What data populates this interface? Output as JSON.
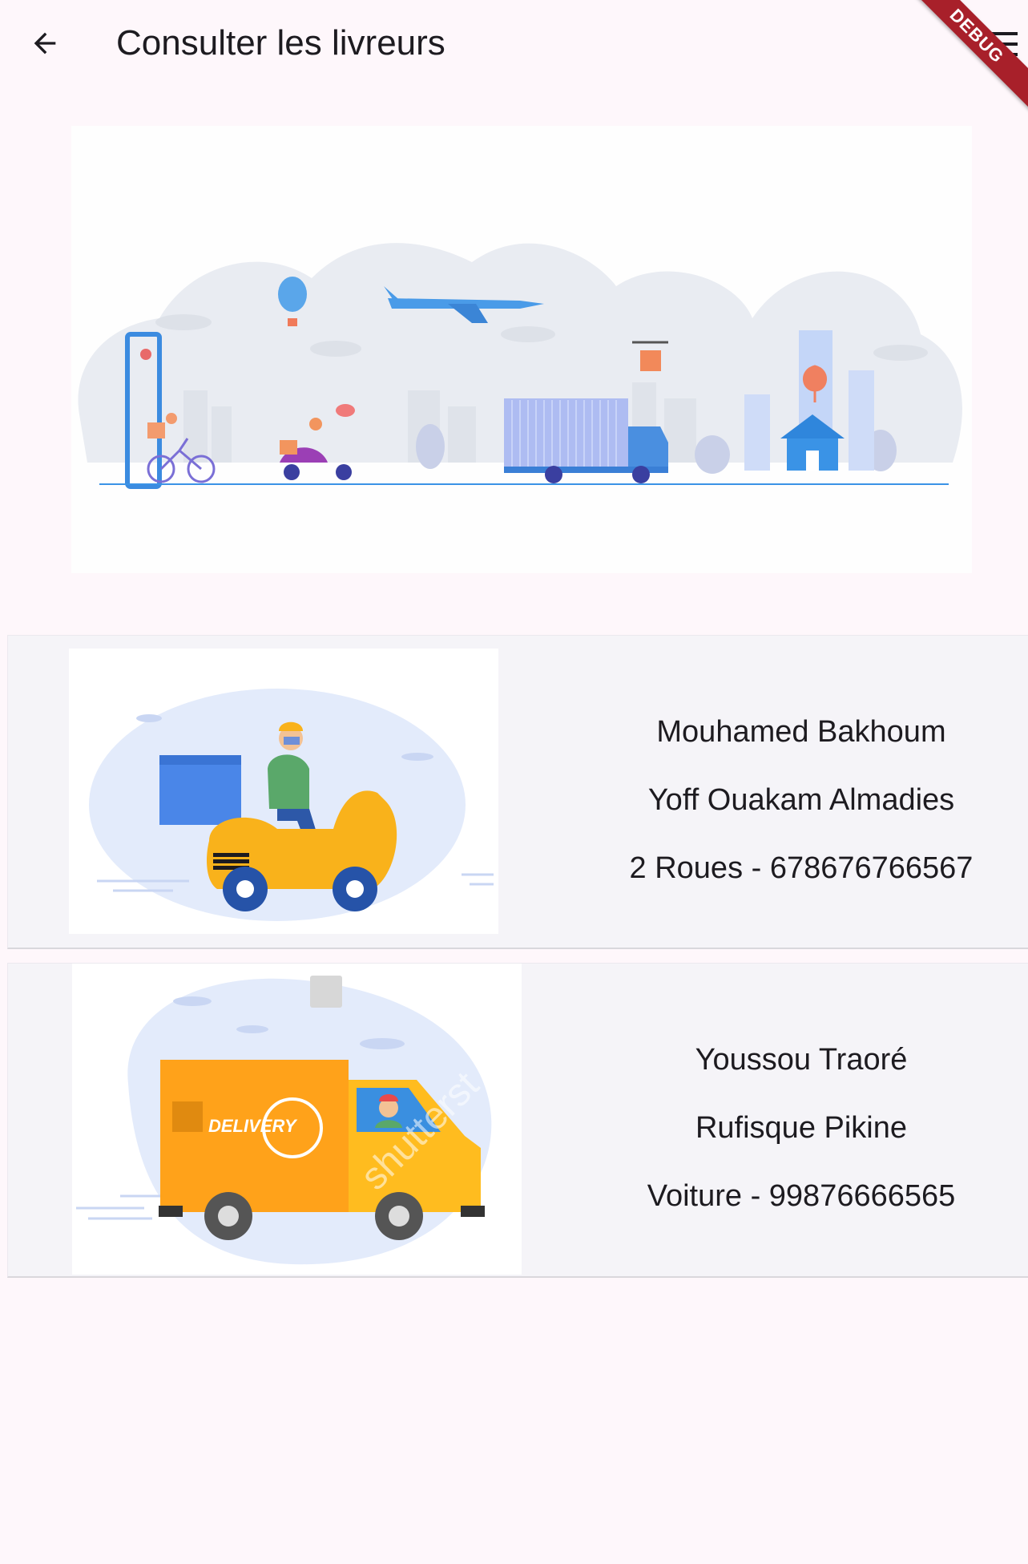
{
  "appbar": {
    "title": "Consulter les livreurs",
    "back_icon": "arrow-back-icon",
    "menu_icon": "menu-icon",
    "debug_label": "DEBUG"
  },
  "hero": {
    "image": "delivery-transport-illustration"
  },
  "couriers": [
    {
      "name": "Mouhamed Bakhoum",
      "area": "Yoff Ouakam Almadies",
      "vehicle_phone": "2 Roues - 678676766567",
      "image": "scooter-delivery-illustration"
    },
    {
      "name": "Youssou Traoré",
      "area": "Rufisque Pikine",
      "vehicle_phone": "Voiture - 99876666565",
      "image": "delivery-van-illustration",
      "van_text": "DELIVERY",
      "watermark": "shutterst"
    }
  ],
  "colors": {
    "background": "#fef7fb",
    "card": "#f5f4f8",
    "debug": "#a8202a",
    "scooter_yellow": "#f9b21b",
    "box_blue": "#4a86e8",
    "van_orange": "#ffa21a"
  }
}
